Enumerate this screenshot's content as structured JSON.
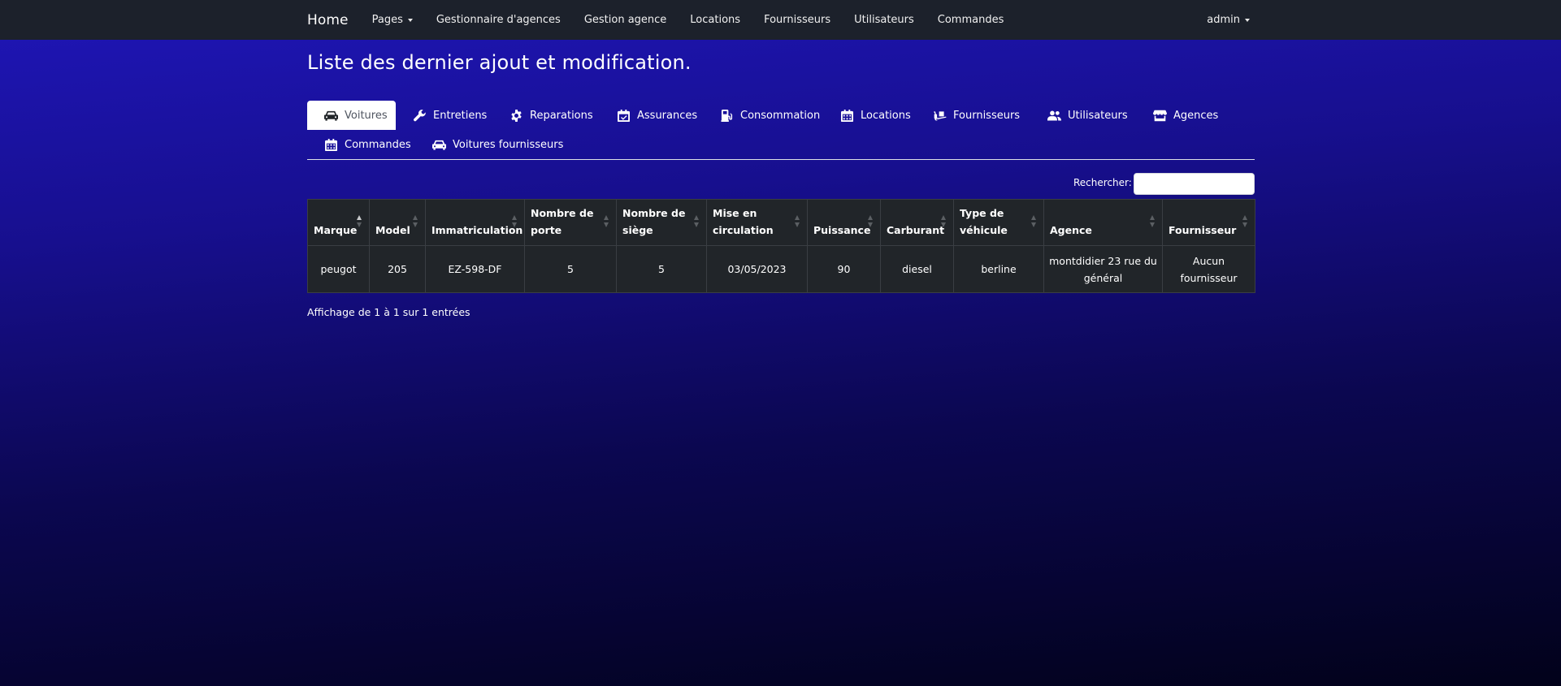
{
  "navbar": {
    "brand": "Home",
    "links": [
      {
        "label": "Pages",
        "dropdown": true
      },
      {
        "label": "Gestionnaire d'agences"
      },
      {
        "label": "Gestion agence"
      },
      {
        "label": "Locations"
      },
      {
        "label": "Fournisseurs"
      },
      {
        "label": "Utilisateurs"
      },
      {
        "label": "Commandes"
      }
    ],
    "user": "admin"
  },
  "page": {
    "title": "Liste des dernier ajout et modification."
  },
  "tabs": [
    {
      "label": "Voitures",
      "icon": "car-icon",
      "active": true
    },
    {
      "label": "Entretiens",
      "icon": "wrench-icon"
    },
    {
      "label": "Reparations",
      "icon": "gear-icon"
    },
    {
      "label": "Assurances",
      "icon": "calendar-check-icon"
    },
    {
      "label": "Consommation",
      "icon": "gas-pump-icon"
    },
    {
      "label": "Locations",
      "icon": "calendar-icon"
    },
    {
      "label": "Fournisseurs",
      "icon": "dolly-icon"
    },
    {
      "label": "Utilisateurs",
      "icon": "users-icon"
    },
    {
      "label": "Agences",
      "icon": "store-icon"
    },
    {
      "label": "Commandes",
      "icon": "calendar-icon"
    },
    {
      "label": "Voitures fournisseurs",
      "icon": "car-icon"
    }
  ],
  "search": {
    "label": "Rechercher:",
    "value": ""
  },
  "table": {
    "columns": [
      "Marque",
      "Model",
      "Immatriculation",
      "Nombre de porte",
      "Nombre de siège",
      "Mise en circulation",
      "Puissance",
      "Carburant",
      "Type de véhicule",
      "Agence",
      "Fournisseur"
    ],
    "sorted_column": "Marque",
    "rows": [
      [
        "peugot",
        "205",
        "EZ-598-DF",
        "5",
        "5",
        "03/05/2023",
        "90",
        "diesel",
        "berline",
        "montdidier 23 rue du général",
        "Aucun fournisseur"
      ]
    ]
  },
  "info": "Affichage de 1 à 1 sur 1 entrées",
  "colors": {
    "navbar": "#1c212b",
    "table_bg": "#212529",
    "bg_top": "#1f16b8",
    "bg_bottom": "#02021a"
  }
}
